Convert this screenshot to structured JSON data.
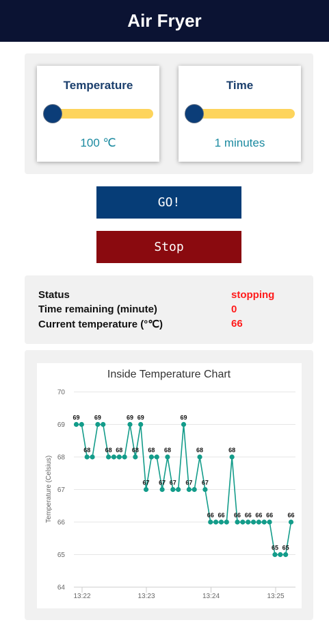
{
  "header": {
    "title": "Air Fryer"
  },
  "controls": {
    "temperature": {
      "label": "Temperature",
      "value_text": "100 ℃",
      "slider_fraction": 0
    },
    "time": {
      "label": "Time",
      "value_text": "1 minutes",
      "slider_fraction": 0
    }
  },
  "buttons": {
    "go_label": "GO!",
    "stop_label": "Stop"
  },
  "status": {
    "rows": [
      {
        "label": "Status",
        "value": "stopping"
      },
      {
        "label": "Time remaining (minute)",
        "value": "0"
      },
      {
        "label": "Current temperature (°℃)",
        "value": "66"
      }
    ]
  },
  "colors": {
    "header_bg": "#0b1333",
    "go_button": "#063d77",
    "stop_button": "#8a0a0f",
    "status_value": "#ff1a1a",
    "slider_track": "#fdd45c",
    "slider_thumb": "#0b3d78",
    "series_line": "#139c8a"
  },
  "chart_data": {
    "type": "line",
    "title": "Inside Temperature Chart",
    "xlabel": "",
    "ylabel": "Temperature (Celsius)",
    "ylim": [
      64,
      70
    ],
    "yticks": [
      "64",
      "65",
      "66",
      "67",
      "68",
      "69",
      "70"
    ],
    "xticks": [
      "13:22",
      "13:23",
      "13:24",
      "13:25"
    ],
    "grid": true,
    "values": [
      69,
      69,
      68,
      68,
      69,
      69,
      68,
      68,
      68,
      68,
      69,
      68,
      69,
      67,
      68,
      68,
      67,
      68,
      67,
      67,
      69,
      67,
      67,
      68,
      67,
      66,
      66,
      66,
      66,
      68,
      66,
      66,
      66,
      66,
      66,
      66,
      66,
      65,
      65,
      65,
      66
    ],
    "labels": [
      "69",
      "",
      "68",
      "",
      "69",
      "",
      "68",
      "",
      "68",
      "",
      "69",
      "68",
      "69",
      "67",
      "68",
      "",
      "67",
      "68",
      "67",
      "",
      "69",
      "67",
      "",
      "68",
      "67",
      "66",
      "",
      "66",
      "",
      "68",
      "66",
      "",
      "66",
      "",
      "66",
      "",
      "66",
      "65",
      "",
      "65",
      "66"
    ]
  }
}
